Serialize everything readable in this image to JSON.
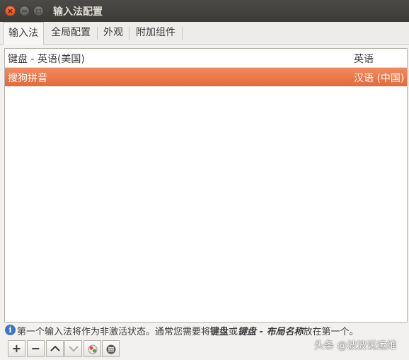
{
  "window": {
    "title": "输入法配置"
  },
  "titlebar_buttons": {
    "close": "×",
    "minimize": "−",
    "maximize": "□"
  },
  "tabs": [
    {
      "label": "输入法"
    },
    {
      "label": "全局配置"
    },
    {
      "label": "外观"
    },
    {
      "label": "附加组件"
    }
  ],
  "list": {
    "header": {
      "name": "键盘 - 英语(美国)",
      "language": "英语"
    },
    "rows": [
      {
        "name": "搜狗拼音",
        "language": "汉语 (中国)"
      }
    ]
  },
  "hint": {
    "part1": "第一个输入法将作为非激活状态。通常您需要将",
    "bold1": "键盘",
    "part2": "或",
    "bold2": "键盘 - 布局名称",
    "part3": "放在第一个。"
  },
  "toolbar": {
    "add": "+",
    "remove": "−"
  },
  "icons": {
    "info": "info-icon",
    "up": "chevron-up-icon",
    "down": "chevron-down-icon",
    "configure": "configure-icon",
    "keyboard": "keyboard-layout-icon"
  },
  "colors": {
    "selection": "#e4693a",
    "titlebar": "#3c3b37",
    "info": "#3875c4"
  },
  "watermark": "头条 @波波说运维"
}
